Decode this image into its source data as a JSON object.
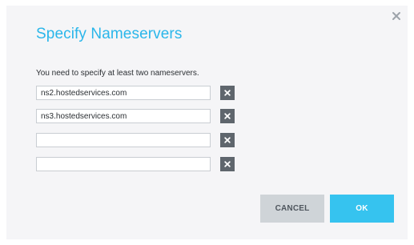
{
  "dialog": {
    "title": "Specify Nameservers",
    "message": "You need to specify at least two nameservers.",
    "close_icon": "close-icon",
    "nameservers": [
      {
        "value": "ns2.hostedservices.com",
        "remove_icon": "remove-icon"
      },
      {
        "value": "ns3.hostedservices.com",
        "remove_icon": "remove-icon"
      },
      {
        "value": "",
        "remove_icon": "remove-icon"
      },
      {
        "value": "",
        "remove_icon": "remove-icon"
      }
    ],
    "buttons": {
      "cancel": "CANCEL",
      "ok": "OK"
    },
    "colors": {
      "title": "#2ab6ea",
      "ok_button": "#36c3ef",
      "cancel_button": "#cfd4d8",
      "remove_button": "#5f666d",
      "dialog_background": "#f5f5f7"
    }
  }
}
